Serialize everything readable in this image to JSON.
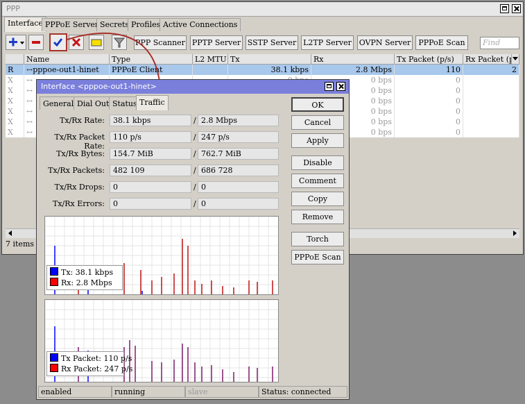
{
  "main_window": {
    "title": "PPP",
    "tabs": [
      "Interface",
      "PPPoE Servers",
      "Secrets",
      "Profiles",
      "Active Connections"
    ],
    "toolbar": {
      "scanner": "PPP Scanner",
      "pptp": "PPTP Server",
      "sstp": "SSTP Server",
      "l2tp": "L2TP Server",
      "ovpn": "OVPN Server",
      "pppoe_scan": "PPPoE Scan",
      "find_placeholder": "Find"
    },
    "columns": [
      "",
      "Name",
      "Type",
      "L2 MTU",
      "Tx",
      "Rx",
      "Tx Packet (p/s)",
      "Rx Packet (p/"
    ],
    "rows": [
      {
        "flag": "R",
        "name": "pppoe-out1-hinet",
        "type": "PPPoE Client",
        "tx": "38.1 kbps",
        "rx": "2.8 Mbps",
        "txp": "110",
        "rxp": "2"
      },
      {
        "flag": "X",
        "name": "",
        "type": "",
        "tx": "0 bps",
        "rx": "0 bps",
        "txp": "0",
        "rxp": ""
      },
      {
        "flag": "X",
        "name": "",
        "type": "",
        "tx": "",
        "rx": "0 bps",
        "txp": "0",
        "rxp": ""
      },
      {
        "flag": "X",
        "name": "",
        "type": "",
        "tx": "",
        "rx": "0 bps",
        "txp": "0",
        "rxp": ""
      },
      {
        "flag": "X",
        "name": "",
        "type": "",
        "tx": "",
        "rx": "0 bps",
        "txp": "0",
        "rxp": ""
      },
      {
        "flag": "X",
        "name": "",
        "type": "",
        "tx": "",
        "rx": "0 bps",
        "txp": "0",
        "rxp": ""
      },
      {
        "flag": "X",
        "name": "",
        "type": "",
        "tx": "",
        "rx": "0 bps",
        "txp": "0",
        "rxp": ""
      }
    ],
    "footer": "7 items o"
  },
  "dialog": {
    "title": "Interface <pppoe-out1-hinet>",
    "tabs": [
      "General",
      "Dial Out",
      "Status",
      "Traffic"
    ],
    "fields": [
      {
        "label": "Tx/Rx Rate:",
        "a": "38.1 kbps",
        "b": "2.8 Mbps"
      },
      {
        "label": "Tx/Rx Packet Rate:",
        "a": "110 p/s",
        "b": "247 p/s"
      },
      {
        "label": "Tx/Rx Bytes:",
        "a": "154.7 MiB",
        "b": "762.7 MiB"
      },
      {
        "label": "Tx/Rx Packets:",
        "a": "482 109",
        "b": "686 728"
      },
      {
        "label": "Tx/Rx Drops:",
        "a": "0",
        "b": "0"
      },
      {
        "label": "Tx/Rx Errors:",
        "a": "0",
        "b": "0"
      }
    ],
    "buttons": [
      "OK",
      "Cancel",
      "Apply",
      "Disable",
      "Comment",
      "Copy",
      "Remove",
      "Torch",
      "PPPoE Scan"
    ],
    "graph1_legend": {
      "tx": "Tx:  38.1 kbps",
      "rx": "Rx:  2.8 Mbps"
    },
    "graph2_legend": {
      "tx": "Tx Packet:  110 p/s",
      "rx": "Rx Packet:  247 p/s"
    },
    "status": [
      "enabled",
      "running",
      "slave",
      "Status: connected"
    ]
  },
  "colors": {
    "tx": "#0000ff",
    "rx": "#ff0000",
    "title_active": "#7a7fdc",
    "selection": "#a8c8ec",
    "accent_arrow": "#a8322a"
  }
}
